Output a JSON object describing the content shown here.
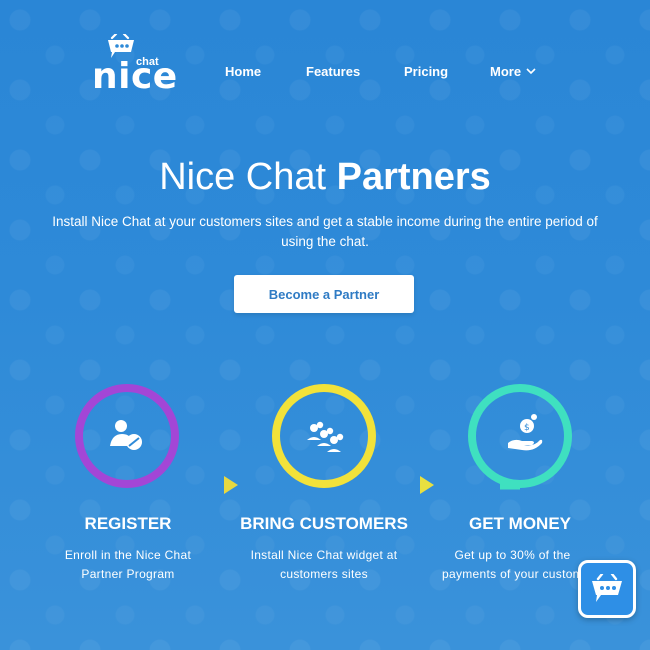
{
  "brand": {
    "logo_main": "nice",
    "logo_sub": "chat"
  },
  "nav": {
    "home": "Home",
    "features": "Features",
    "pricing": "Pricing",
    "more": "More"
  },
  "hero": {
    "title_light": "Nice Chat ",
    "title_bold": "Partners",
    "subtitle": "Install Nice Chat at your customers sites and get a stable income during the entire period of using the chat.",
    "cta_label": "Become a Partner"
  },
  "steps": [
    {
      "title": "REGISTER",
      "line1": "Enroll in the Nice Chat",
      "line2": "Partner Program",
      "icon": "user-register-icon",
      "color": "#a346d6"
    },
    {
      "title": "BRING CUSTOMERS",
      "line1": "Install Nice Chat widget at",
      "line2": "customers sites",
      "icon": "add-customers-icon",
      "color": "#f2e23a"
    },
    {
      "title": "GET MONEY",
      "line1": "Get up to 30% of the",
      "line2": "payments of your custom",
      "icon": "money-hand-icon",
      "color": "#3fe0c0"
    }
  ],
  "colors": {
    "background": "#2e8ad8",
    "cta_text": "#2f7bc4",
    "widget": "#2e8fe6"
  }
}
